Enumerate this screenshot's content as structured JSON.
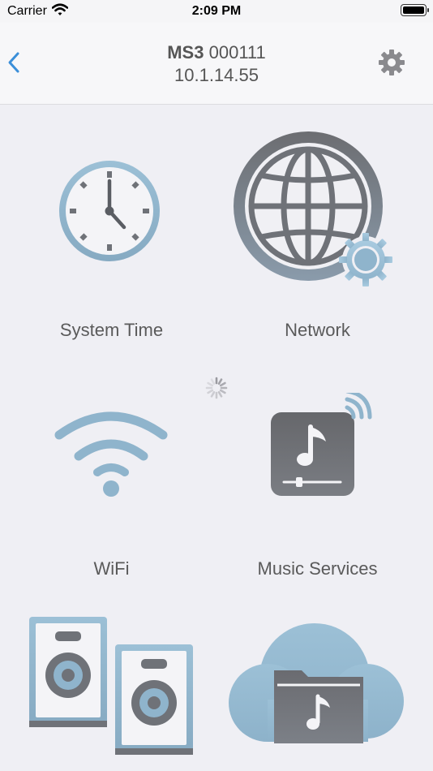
{
  "status_bar": {
    "carrier": "Carrier",
    "time": "2:09 PM",
    "icons": [
      "wifi-icon",
      "battery-icon"
    ]
  },
  "nav": {
    "model": "MS3",
    "serial": "000111",
    "ip": "10.1.14.55",
    "icons": [
      "chevron-left-icon",
      "gear-icon"
    ]
  },
  "tiles": [
    {
      "label": "System Time",
      "icon": "clock-icon"
    },
    {
      "label": "Network",
      "icon": "globe-gear-icon"
    },
    {
      "label": "WiFi",
      "icon": "wifi-icon"
    },
    {
      "label": "Music Services",
      "icon": "music-streaming-icon"
    },
    {
      "label": "",
      "icon": "speakers-icon"
    },
    {
      "label": "",
      "icon": "cloud-music-folder-icon"
    }
  ],
  "colors": {
    "accent": "#3b8fd9",
    "icon_blue": "#8fb4cc",
    "icon_gray": "#6f7278",
    "background": "#efeff4"
  }
}
